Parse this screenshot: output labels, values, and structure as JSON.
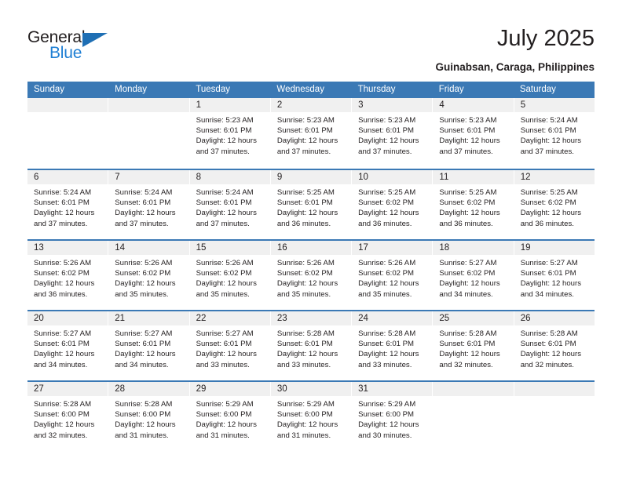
{
  "brand": {
    "name_part1": "General",
    "name_part2": "Blue",
    "triangle_icon": "triangle-icon",
    "colors": {
      "black": "#231f20",
      "blue": "#1f7fd4",
      "triangle": "#1f6fb4"
    }
  },
  "header": {
    "title": "July 2025",
    "subtitle": "Guinabsan, Caraga, Philippines"
  },
  "calendar": {
    "accent_color": "#3b79b5",
    "daynum_band_color": "#f0f0f0",
    "day_names": [
      "Sunday",
      "Monday",
      "Tuesday",
      "Wednesday",
      "Thursday",
      "Friday",
      "Saturday"
    ],
    "weeks": [
      [
        {
          "day": "",
          "lines": []
        },
        {
          "day": "",
          "lines": []
        },
        {
          "day": "1",
          "lines": [
            "Sunrise: 5:23 AM",
            "Sunset: 6:01 PM",
            "Daylight: 12 hours",
            "and 37 minutes."
          ]
        },
        {
          "day": "2",
          "lines": [
            "Sunrise: 5:23 AM",
            "Sunset: 6:01 PM",
            "Daylight: 12 hours",
            "and 37 minutes."
          ]
        },
        {
          "day": "3",
          "lines": [
            "Sunrise: 5:23 AM",
            "Sunset: 6:01 PM",
            "Daylight: 12 hours",
            "and 37 minutes."
          ]
        },
        {
          "day": "4",
          "lines": [
            "Sunrise: 5:23 AM",
            "Sunset: 6:01 PM",
            "Daylight: 12 hours",
            "and 37 minutes."
          ]
        },
        {
          "day": "5",
          "lines": [
            "Sunrise: 5:24 AM",
            "Sunset: 6:01 PM",
            "Daylight: 12 hours",
            "and 37 minutes."
          ]
        }
      ],
      [
        {
          "day": "6",
          "lines": [
            "Sunrise: 5:24 AM",
            "Sunset: 6:01 PM",
            "Daylight: 12 hours",
            "and 37 minutes."
          ]
        },
        {
          "day": "7",
          "lines": [
            "Sunrise: 5:24 AM",
            "Sunset: 6:01 PM",
            "Daylight: 12 hours",
            "and 37 minutes."
          ]
        },
        {
          "day": "8",
          "lines": [
            "Sunrise: 5:24 AM",
            "Sunset: 6:01 PM",
            "Daylight: 12 hours",
            "and 37 minutes."
          ]
        },
        {
          "day": "9",
          "lines": [
            "Sunrise: 5:25 AM",
            "Sunset: 6:01 PM",
            "Daylight: 12 hours",
            "and 36 minutes."
          ]
        },
        {
          "day": "10",
          "lines": [
            "Sunrise: 5:25 AM",
            "Sunset: 6:02 PM",
            "Daylight: 12 hours",
            "and 36 minutes."
          ]
        },
        {
          "day": "11",
          "lines": [
            "Sunrise: 5:25 AM",
            "Sunset: 6:02 PM",
            "Daylight: 12 hours",
            "and 36 minutes."
          ]
        },
        {
          "day": "12",
          "lines": [
            "Sunrise: 5:25 AM",
            "Sunset: 6:02 PM",
            "Daylight: 12 hours",
            "and 36 minutes."
          ]
        }
      ],
      [
        {
          "day": "13",
          "lines": [
            "Sunrise: 5:26 AM",
            "Sunset: 6:02 PM",
            "Daylight: 12 hours",
            "and 36 minutes."
          ]
        },
        {
          "day": "14",
          "lines": [
            "Sunrise: 5:26 AM",
            "Sunset: 6:02 PM",
            "Daylight: 12 hours",
            "and 35 minutes."
          ]
        },
        {
          "day": "15",
          "lines": [
            "Sunrise: 5:26 AM",
            "Sunset: 6:02 PM",
            "Daylight: 12 hours",
            "and 35 minutes."
          ]
        },
        {
          "day": "16",
          "lines": [
            "Sunrise: 5:26 AM",
            "Sunset: 6:02 PM",
            "Daylight: 12 hours",
            "and 35 minutes."
          ]
        },
        {
          "day": "17",
          "lines": [
            "Sunrise: 5:26 AM",
            "Sunset: 6:02 PM",
            "Daylight: 12 hours",
            "and 35 minutes."
          ]
        },
        {
          "day": "18",
          "lines": [
            "Sunrise: 5:27 AM",
            "Sunset: 6:02 PM",
            "Daylight: 12 hours",
            "and 34 minutes."
          ]
        },
        {
          "day": "19",
          "lines": [
            "Sunrise: 5:27 AM",
            "Sunset: 6:01 PM",
            "Daylight: 12 hours",
            "and 34 minutes."
          ]
        }
      ],
      [
        {
          "day": "20",
          "lines": [
            "Sunrise: 5:27 AM",
            "Sunset: 6:01 PM",
            "Daylight: 12 hours",
            "and 34 minutes."
          ]
        },
        {
          "day": "21",
          "lines": [
            "Sunrise: 5:27 AM",
            "Sunset: 6:01 PM",
            "Daylight: 12 hours",
            "and 34 minutes."
          ]
        },
        {
          "day": "22",
          "lines": [
            "Sunrise: 5:27 AM",
            "Sunset: 6:01 PM",
            "Daylight: 12 hours",
            "and 33 minutes."
          ]
        },
        {
          "day": "23",
          "lines": [
            "Sunrise: 5:28 AM",
            "Sunset: 6:01 PM",
            "Daylight: 12 hours",
            "and 33 minutes."
          ]
        },
        {
          "day": "24",
          "lines": [
            "Sunrise: 5:28 AM",
            "Sunset: 6:01 PM",
            "Daylight: 12 hours",
            "and 33 minutes."
          ]
        },
        {
          "day": "25",
          "lines": [
            "Sunrise: 5:28 AM",
            "Sunset: 6:01 PM",
            "Daylight: 12 hours",
            "and 32 minutes."
          ]
        },
        {
          "day": "26",
          "lines": [
            "Sunrise: 5:28 AM",
            "Sunset: 6:01 PM",
            "Daylight: 12 hours",
            "and 32 minutes."
          ]
        }
      ],
      [
        {
          "day": "27",
          "lines": [
            "Sunrise: 5:28 AM",
            "Sunset: 6:00 PM",
            "Daylight: 12 hours",
            "and 32 minutes."
          ]
        },
        {
          "day": "28",
          "lines": [
            "Sunrise: 5:28 AM",
            "Sunset: 6:00 PM",
            "Daylight: 12 hours",
            "and 31 minutes."
          ]
        },
        {
          "day": "29",
          "lines": [
            "Sunrise: 5:29 AM",
            "Sunset: 6:00 PM",
            "Daylight: 12 hours",
            "and 31 minutes."
          ]
        },
        {
          "day": "30",
          "lines": [
            "Sunrise: 5:29 AM",
            "Sunset: 6:00 PM",
            "Daylight: 12 hours",
            "and 31 minutes."
          ]
        },
        {
          "day": "31",
          "lines": [
            "Sunrise: 5:29 AM",
            "Sunset: 6:00 PM",
            "Daylight: 12 hours",
            "and 30 minutes."
          ]
        },
        {
          "day": "",
          "lines": []
        },
        {
          "day": "",
          "lines": []
        }
      ]
    ]
  }
}
